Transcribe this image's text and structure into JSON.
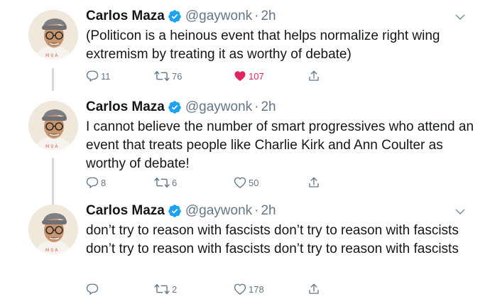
{
  "colors": {
    "accent": "#1da1f2",
    "like": "#e0245e",
    "muted": "#657786",
    "text": "#14171a"
  },
  "tweets": [
    {
      "name": "Carlos Maza",
      "handle": "@gaywonk",
      "sep": "·",
      "time": "2h",
      "text": "(Politicon is a heinous event that helps normalize right wing extremism by treating it as worthy of debate)",
      "replies": "11",
      "retweets": "76",
      "likes": "107",
      "liked": true
    },
    {
      "name": "Carlos Maza",
      "handle": "@gaywonk",
      "sep": "·",
      "time": "2h",
      "text": "I cannot believe the number of smart progressives who attend an event that treats people like Charlie Kirk and Ann Coulter as worthy of debate!",
      "replies": "8",
      "retweets": "6",
      "likes": "50",
      "liked": false
    },
    {
      "name": "Carlos Maza",
      "handle": "@gaywonk",
      "sep": "·",
      "time": "2h",
      "text": "don’t try to reason with fascists don’t try to reason with fascists don’t try to reason with fascists don’t try to reason with fascists",
      "replies": "",
      "retweets": "2",
      "likes": "178",
      "liked": false
    }
  ]
}
